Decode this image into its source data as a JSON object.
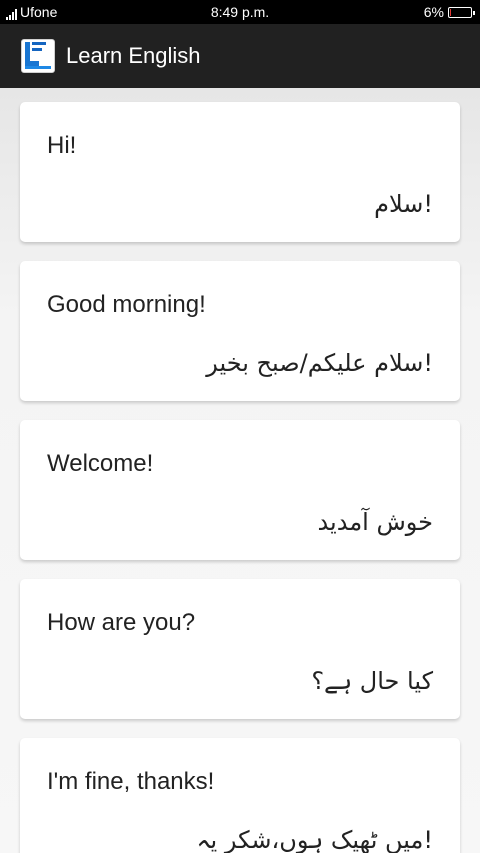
{
  "status_bar": {
    "carrier": "Ufone",
    "time": "8:49 p.m.",
    "battery_percent": "6%",
    "battery_level": 0.06,
    "battery_color": "#e53935"
  },
  "app_bar": {
    "logo_icon": "learn-english-logo",
    "title": "Learn English"
  },
  "phrases": [
    {
      "english": "Hi!",
      "urdu": "!سلام"
    },
    {
      "english": "Good morning!",
      "urdu": "!سلام علیکم/صبح بخیر"
    },
    {
      "english": "Welcome!",
      "urdu": "خوش آمدید"
    },
    {
      "english": "How are you?",
      "urdu": "کیا حال ہے؟"
    },
    {
      "english": "I'm fine, thanks!",
      "urdu": "!میں ٹھیک ہوں،شکر یہ"
    }
  ]
}
